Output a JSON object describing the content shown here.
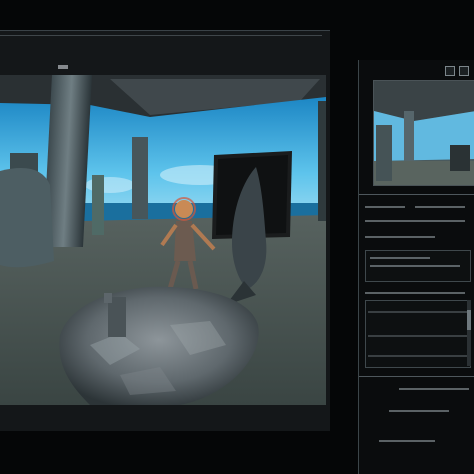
{
  "top_right_label": "",
  "window": {
    "title": "",
    "scene_label": ""
  },
  "viewport": {
    "sky_color": "#3aa6d8",
    "ground_color": "#5f6a66",
    "water_color": "#1e7fb0"
  },
  "panel": {
    "title": "",
    "fields": [
      {
        "label": ""
      },
      {
        "label": ""
      },
      {
        "label": ""
      },
      {
        "label": ""
      }
    ],
    "footer": [
      {
        "label": ""
      },
      {
        "label": ""
      },
      {
        "label": ""
      }
    ]
  },
  "icons": {
    "panel_close": "close-icon",
    "panel_settings": "gear-icon"
  }
}
